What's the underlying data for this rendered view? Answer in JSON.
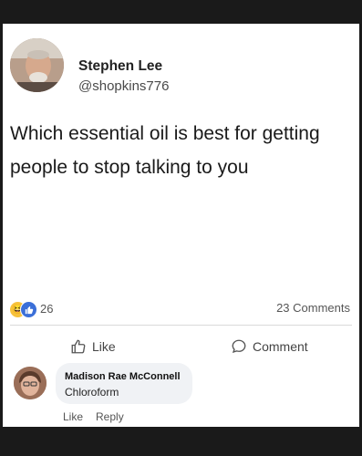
{
  "post": {
    "author_name": "Stephen Lee",
    "author_handle": "@shopkins776",
    "text": "Which essential oil is best for getting people to stop talking to you"
  },
  "stats": {
    "reaction_count": "26",
    "comment_count": "23 Comments"
  },
  "actions": {
    "like_label": "Like",
    "comment_label": "Comment"
  },
  "comment": {
    "author": "Madison Rae McConnell",
    "text": "Chloroform",
    "like_label": "Like",
    "reply_label": "Reply"
  },
  "colors": {
    "like_blue": "#3b6fd8",
    "haha_yellow": "#f7c23c",
    "bubble": "#f0f2f5"
  },
  "icons": {
    "haha_reaction": "haha-reaction-icon",
    "like_reaction": "like-reaction-icon",
    "like_action": "thumbs-up-icon",
    "comment_action": "comment-bubble-icon"
  }
}
